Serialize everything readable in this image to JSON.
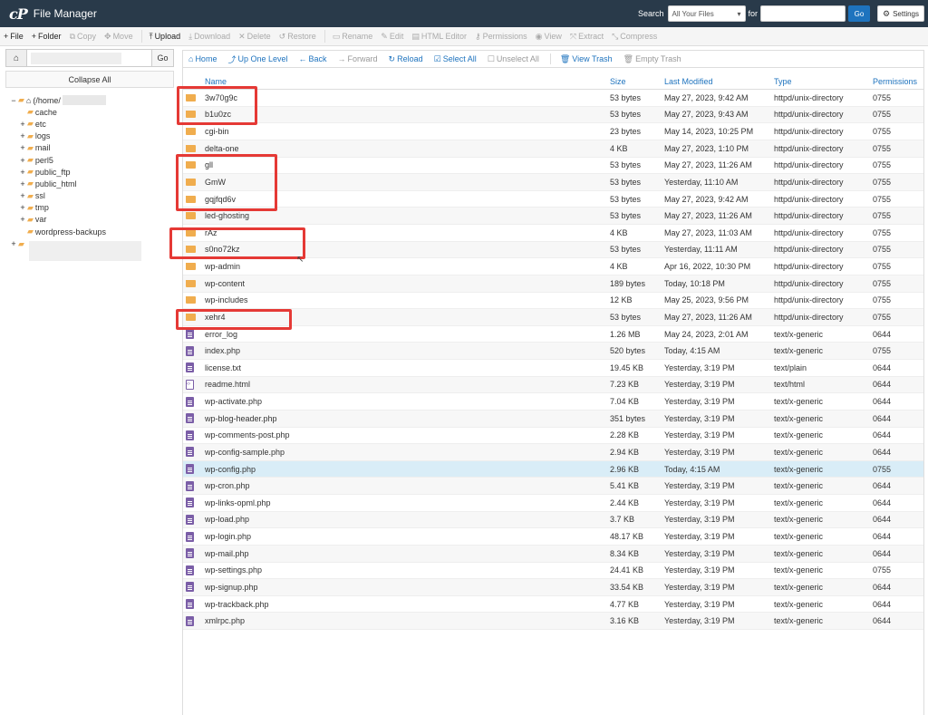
{
  "header": {
    "logo": "cP",
    "title": "File Manager",
    "search_label": "Search",
    "search_scope": "All Your Files",
    "for_label": "for",
    "go_label": "Go",
    "settings_label": "Settings"
  },
  "toolbar": {
    "items": [
      {
        "name": "file-button",
        "icon": "+",
        "label": "File",
        "enabled": true
      },
      {
        "name": "folder-button",
        "icon": "+",
        "label": "Folder",
        "enabled": true
      },
      {
        "name": "copy-button",
        "icon": "⧉",
        "label": "Copy",
        "enabled": false
      },
      {
        "name": "move-button",
        "icon": "✥",
        "label": "Move",
        "enabled": false
      },
      {
        "name": "upload-button",
        "icon": "⤒",
        "label": "Upload",
        "enabled": true
      },
      {
        "name": "download-button",
        "icon": "⤓",
        "label": "Download",
        "enabled": false
      },
      {
        "name": "delete-button",
        "icon": "✕",
        "label": "Delete",
        "enabled": false
      },
      {
        "name": "restore-button",
        "icon": "↺",
        "label": "Restore",
        "enabled": false
      },
      {
        "name": "rename-button",
        "icon": "▭",
        "label": "Rename",
        "enabled": false
      },
      {
        "name": "edit-button",
        "icon": "✎",
        "label": "Edit",
        "enabled": false
      },
      {
        "name": "html-editor-button",
        "icon": "▤",
        "label": "HTML Editor",
        "enabled": false
      },
      {
        "name": "permissions-button",
        "icon": "⚷",
        "label": "Permissions",
        "enabled": false
      },
      {
        "name": "view-button",
        "icon": "◉",
        "label": "View",
        "enabled": false
      },
      {
        "name": "extract-button",
        "icon": "⤧",
        "label": "Extract",
        "enabled": false
      },
      {
        "name": "compress-button",
        "icon": "⤡",
        "label": "Compress",
        "enabled": false
      }
    ]
  },
  "sidebar": {
    "go_label": "Go",
    "collapse_label": "Collapse All",
    "root_label": "(/home/",
    "tree": [
      {
        "label": "cache",
        "toggle": ""
      },
      {
        "label": "etc",
        "toggle": "+"
      },
      {
        "label": "logs",
        "toggle": "+"
      },
      {
        "label": "mail",
        "toggle": "+"
      },
      {
        "label": "perl5",
        "toggle": "+"
      },
      {
        "label": "public_ftp",
        "toggle": "+"
      },
      {
        "label": "public_html",
        "toggle": "+"
      },
      {
        "label": "ssl",
        "toggle": "+"
      },
      {
        "label": "tmp",
        "toggle": "+"
      },
      {
        "label": "var",
        "toggle": "+"
      },
      {
        "label": "wordpress-backups",
        "toggle": ""
      }
    ]
  },
  "main_toolbar": {
    "items": [
      {
        "name": "home-link",
        "icon": "⌂",
        "label": "Home",
        "enabled": true
      },
      {
        "name": "up-one-level-link",
        "icon": "⤴",
        "label": "Up One Level",
        "enabled": true
      },
      {
        "name": "back-link",
        "icon": "←",
        "label": "Back",
        "enabled": true
      },
      {
        "name": "forward-link",
        "icon": "→",
        "label": "Forward",
        "enabled": false
      },
      {
        "name": "reload-link",
        "icon": "↻",
        "label": "Reload",
        "enabled": true
      },
      {
        "name": "select-all-link",
        "icon": "☑",
        "label": "Select All",
        "enabled": true
      },
      {
        "name": "unselect-all-link",
        "icon": "☐",
        "label": "Unselect All",
        "enabled": false
      },
      {
        "name": "view-trash-link",
        "icon": "🗑",
        "label": "View Trash",
        "enabled": true
      },
      {
        "name": "empty-trash-link",
        "icon": "🗑",
        "label": "Empty Trash",
        "enabled": false
      }
    ]
  },
  "table": {
    "headers": {
      "name": "Name",
      "size": "Size",
      "modified": "Last Modified",
      "type": "Type",
      "perms": "Permissions"
    },
    "rows": [
      {
        "kind": "folder",
        "name": "3w70g9c",
        "size": "53 bytes",
        "modified": "May 27, 2023, 9:42 AM",
        "type": "httpd/unix-directory",
        "perms": "0755"
      },
      {
        "kind": "folder",
        "name": "b1u0zc",
        "size": "53 bytes",
        "modified": "May 27, 2023, 9:43 AM",
        "type": "httpd/unix-directory",
        "perms": "0755"
      },
      {
        "kind": "folder",
        "name": "cgi-bin",
        "size": "23 bytes",
        "modified": "May 14, 2023, 10:25 PM",
        "type": "httpd/unix-directory",
        "perms": "0755"
      },
      {
        "kind": "folder",
        "name": "delta-one",
        "size": "4 KB",
        "modified": "May 27, 2023, 1:10 PM",
        "type": "httpd/unix-directory",
        "perms": "0755"
      },
      {
        "kind": "folder",
        "name": "gll",
        "size": "53 bytes",
        "modified": "May 27, 2023, 11:26 AM",
        "type": "httpd/unix-directory",
        "perms": "0755"
      },
      {
        "kind": "folder",
        "name": "GmW",
        "size": "53 bytes",
        "modified": "Yesterday, 11:10 AM",
        "type": "httpd/unix-directory",
        "perms": "0755"
      },
      {
        "kind": "folder",
        "name": "gqjfqd6v",
        "size": "53 bytes",
        "modified": "May 27, 2023, 9:42 AM",
        "type": "httpd/unix-directory",
        "perms": "0755"
      },
      {
        "kind": "folder",
        "name": "led-ghosting",
        "size": "53 bytes",
        "modified": "May 27, 2023, 11:26 AM",
        "type": "httpd/unix-directory",
        "perms": "0755"
      },
      {
        "kind": "folder",
        "name": "rAz",
        "size": "4 KB",
        "modified": "May 27, 2023, 11:03 AM",
        "type": "httpd/unix-directory",
        "perms": "0755"
      },
      {
        "kind": "folder",
        "name": "s0no72kz",
        "size": "53 bytes",
        "modified": "Yesterday, 11:11 AM",
        "type": "httpd/unix-directory",
        "perms": "0755"
      },
      {
        "kind": "folder",
        "name": "wp-admin",
        "size": "4 KB",
        "modified": "Apr 16, 2022, 10:30 PM",
        "type": "httpd/unix-directory",
        "perms": "0755"
      },
      {
        "kind": "folder",
        "name": "wp-content",
        "size": "189 bytes",
        "modified": "Today, 10:18 PM",
        "type": "httpd/unix-directory",
        "perms": "0755"
      },
      {
        "kind": "folder",
        "name": "wp-includes",
        "size": "12 KB",
        "modified": "May 25, 2023, 9:56 PM",
        "type": "httpd/unix-directory",
        "perms": "0755"
      },
      {
        "kind": "folder",
        "name": "xehr4",
        "size": "53 bytes",
        "modified": "May 27, 2023, 11:26 AM",
        "type": "httpd/unix-directory",
        "perms": "0755"
      },
      {
        "kind": "file",
        "name": "error_log",
        "size": "1.26 MB",
        "modified": "May 24, 2023, 2:01 AM",
        "type": "text/x-generic",
        "perms": "0644"
      },
      {
        "kind": "file",
        "name": "index.php",
        "size": "520 bytes",
        "modified": "Today, 4:15 AM",
        "type": "text/x-generic",
        "perms": "0755"
      },
      {
        "kind": "file",
        "name": "license.txt",
        "size": "19.45 KB",
        "modified": "Yesterday, 3:19 PM",
        "type": "text/plain",
        "perms": "0644"
      },
      {
        "kind": "html",
        "name": "readme.html",
        "size": "7.23 KB",
        "modified": "Yesterday, 3:19 PM",
        "type": "text/html",
        "perms": "0644"
      },
      {
        "kind": "file",
        "name": "wp-activate.php",
        "size": "7.04 KB",
        "modified": "Yesterday, 3:19 PM",
        "type": "text/x-generic",
        "perms": "0644"
      },
      {
        "kind": "file",
        "name": "wp-blog-header.php",
        "size": "351 bytes",
        "modified": "Yesterday, 3:19 PM",
        "type": "text/x-generic",
        "perms": "0644"
      },
      {
        "kind": "file",
        "name": "wp-comments-post.php",
        "size": "2.28 KB",
        "modified": "Yesterday, 3:19 PM",
        "type": "text/x-generic",
        "perms": "0644"
      },
      {
        "kind": "file",
        "name": "wp-config-sample.php",
        "size": "2.94 KB",
        "modified": "Yesterday, 3:19 PM",
        "type": "text/x-generic",
        "perms": "0644"
      },
      {
        "kind": "file",
        "name": "wp-config.php",
        "size": "2.96 KB",
        "modified": "Today, 4:15 AM",
        "type": "text/x-generic",
        "perms": "0755",
        "selected": true
      },
      {
        "kind": "file",
        "name": "wp-cron.php",
        "size": "5.41 KB",
        "modified": "Yesterday, 3:19 PM",
        "type": "text/x-generic",
        "perms": "0644"
      },
      {
        "kind": "file",
        "name": "wp-links-opml.php",
        "size": "2.44 KB",
        "modified": "Yesterday, 3:19 PM",
        "type": "text/x-generic",
        "perms": "0644"
      },
      {
        "kind": "file",
        "name": "wp-load.php",
        "size": "3.7 KB",
        "modified": "Yesterday, 3:19 PM",
        "type": "text/x-generic",
        "perms": "0644"
      },
      {
        "kind": "file",
        "name": "wp-login.php",
        "size": "48.17 KB",
        "modified": "Yesterday, 3:19 PM",
        "type": "text/x-generic",
        "perms": "0644"
      },
      {
        "kind": "file",
        "name": "wp-mail.php",
        "size": "8.34 KB",
        "modified": "Yesterday, 3:19 PM",
        "type": "text/x-generic",
        "perms": "0644"
      },
      {
        "kind": "file",
        "name": "wp-settings.php",
        "size": "24.41 KB",
        "modified": "Yesterday, 3:19 PM",
        "type": "text/x-generic",
        "perms": "0755"
      },
      {
        "kind": "file",
        "name": "wp-signup.php",
        "size": "33.54 KB",
        "modified": "Yesterday, 3:19 PM",
        "type": "text/x-generic",
        "perms": "0644"
      },
      {
        "kind": "file",
        "name": "wp-trackback.php",
        "size": "4.77 KB",
        "modified": "Yesterday, 3:19 PM",
        "type": "text/x-generic",
        "perms": "0644"
      },
      {
        "kind": "file",
        "name": "xmlrpc.php",
        "size": "3.16 KB",
        "modified": "Yesterday, 3:19 PM",
        "type": "text/x-generic",
        "perms": "0644"
      }
    ]
  },
  "colors": {
    "header_bg": "#293a4a",
    "link_blue": "#1e73be",
    "folder": "#f0ad4e",
    "file": "#7b5ea7",
    "highlight_red": "#e53935",
    "selected_row": "#d9edf7"
  }
}
